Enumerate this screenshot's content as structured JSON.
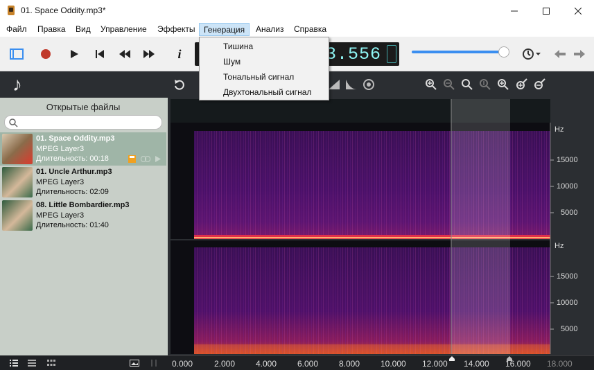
{
  "window": {
    "title": "01. Space Oddity.mp3*"
  },
  "menu": [
    "Файл",
    "Правка",
    "Вид",
    "Управление",
    "Эффекты",
    "Генерация",
    "Анализ",
    "Справка"
  ],
  "generation_menu": [
    "Тишина",
    "Шум",
    "Тональный сигнал",
    "Двухтональный сигнал"
  ],
  "counter": {
    "value": "3.556"
  },
  "volume_level_fraction": 0.9,
  "sidebar": {
    "title": "Открытые файлы",
    "files": [
      {
        "name": "01. Space Oddity.mp3",
        "format": "MPEG Layer3",
        "duration": "Длительность: 00:18"
      },
      {
        "name": "01. Uncle Arthur.mp3",
        "format": "MPEG Layer3",
        "duration": "Длительность: 02:09"
      },
      {
        "name": "08. Little Bombardier.mp3",
        "format": "MPEG Layer3",
        "duration": "Длительность: 01:40"
      }
    ]
  },
  "spectrogram": {
    "unit": "Hz",
    "freq_ticks": [
      "15000",
      "10000",
      "5000"
    ],
    "time_ticks": [
      "0.000",
      "2.000",
      "4.000",
      "6.000",
      "8.000",
      "10.000",
      "12.000",
      "14.000",
      "16.000",
      "18.000"
    ]
  },
  "colors": {
    "accent": "#3a8ef0",
    "counter_text": "#8ff5f4",
    "record": "#c0392b"
  },
  "icons": [
    "app-icon",
    "minimize-icon",
    "maximize-icon",
    "close-icon",
    "record-icon",
    "play-icon",
    "skip-start-icon",
    "rewind-icon",
    "fast-forward-icon",
    "info-icon",
    "history-icon",
    "back-arrow-icon",
    "forward-arrow-icon",
    "music-note-icon",
    "undo-icon",
    "zoom-in-icon",
    "zoom-out-icon",
    "search-icon"
  ]
}
